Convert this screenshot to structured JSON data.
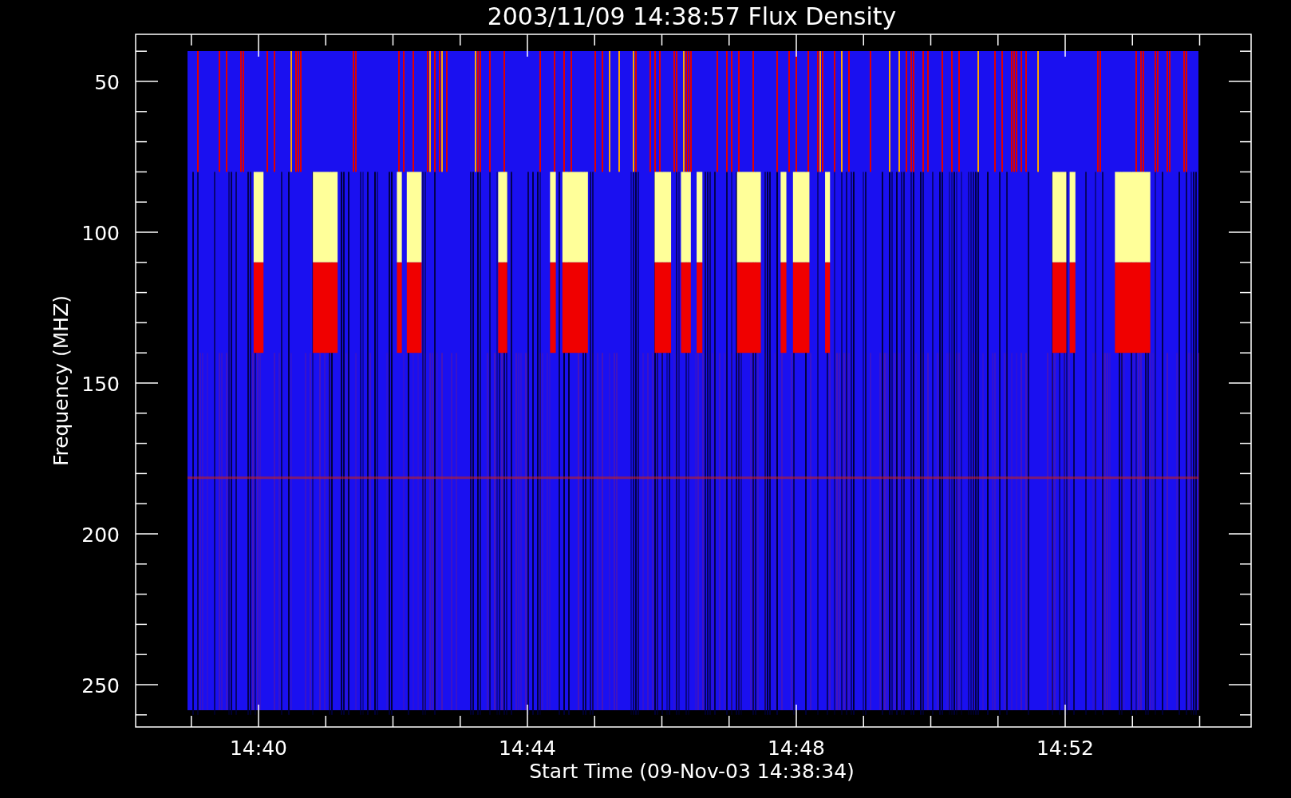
{
  "plot": {
    "title": "2003/11/09 14:38:57 Flux Density",
    "xlabel": "Start Time (09-Nov-03 14:38:34)",
    "ylabel": "Frequency (MHZ)",
    "y_tick_labels": [
      "50",
      "100",
      "150",
      "200",
      "250"
    ],
    "x_tick_labels": [
      "14:40",
      "14:44",
      "14:48",
      "14:52"
    ]
  }
}
